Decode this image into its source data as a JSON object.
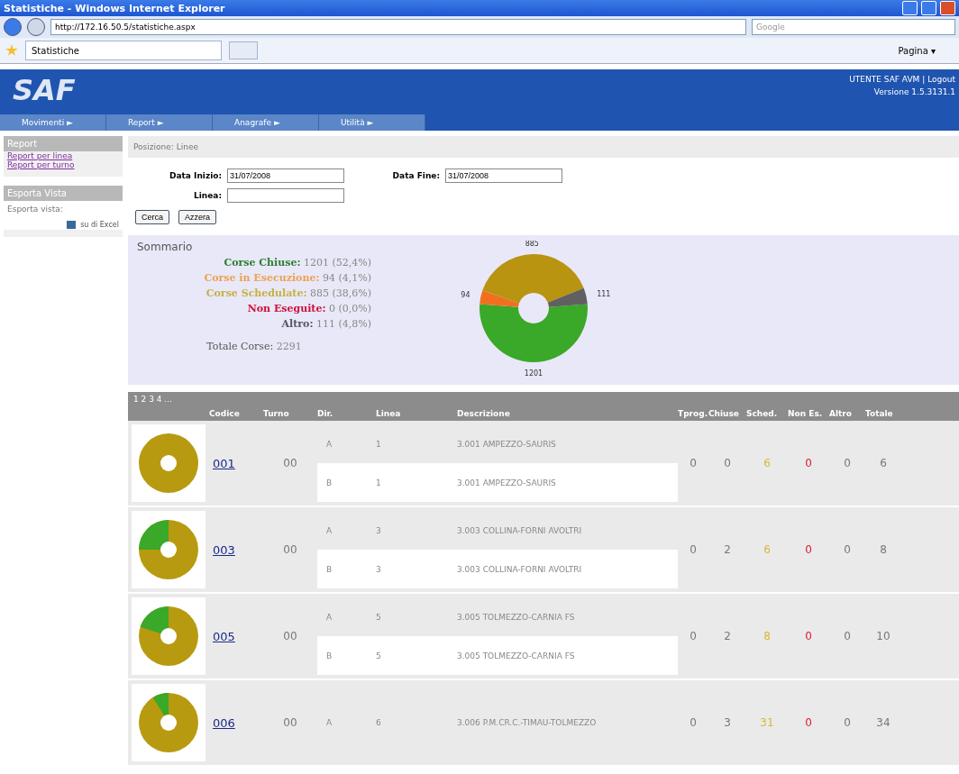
{
  "window": {
    "title": "Statistiche - Windows Internet Explorer"
  },
  "browser": {
    "address": "http://172.16.50.5/statistiche.aspx",
    "search_placeholder": "Google",
    "tab": "Statistiche",
    "tools": [
      "Pagina ▾"
    ]
  },
  "header": {
    "logo": "SAF",
    "user": "UTENTE SAF AVM",
    "separator": "|",
    "logout": "Logout",
    "version": "Versione 1.5.3131.1"
  },
  "menu": [
    {
      "label": "Movimenti",
      "arrow": "►"
    },
    {
      "label": "Report",
      "arrow": "►"
    },
    {
      "label": "Anagrafe",
      "arrow": "►"
    },
    {
      "label": "Utilità",
      "arrow": "►"
    }
  ],
  "sidebar": {
    "sections": [
      {
        "title": "Report",
        "items": [
          {
            "kind": "link",
            "text": "Report per linea"
          },
          {
            "kind": "link",
            "text": "Report per turno"
          }
        ]
      },
      {
        "title": "Esporta Vista",
        "items": [
          {
            "kind": "text",
            "text": "Esporta vista:"
          },
          {
            "kind": "export",
            "text": "su di Excel"
          }
        ]
      }
    ]
  },
  "breadcrumb": "Posizione: Linee",
  "form": {
    "fields": [
      {
        "label": "Data Inizio:",
        "value": "31/07/2008"
      },
      {
        "label": "Data Fine:",
        "value": "31/07/2008"
      },
      {
        "label": "Linea:"
      }
    ],
    "buttons": [
      "Cerca",
      "Azzera"
    ]
  },
  "summary": {
    "title": "Sommario",
    "lines": [
      {
        "label": "Corse Chiuse:",
        "value": "1201 (52,4%)",
        "color": "#2e7d32"
      },
      {
        "label": "Corse in Esecuzione:",
        "value": "94 (4,1%)",
        "color": "#f0a050"
      },
      {
        "label": "Corse Schedulate:",
        "value": "885 (38,6%)",
        "color": "#c8b040"
      },
      {
        "label": "Non Eseguite:",
        "value": "0 (0,0%)",
        "color": "#d0103a"
      },
      {
        "label": "Altro:",
        "value": "111 (4,8%)",
        "color": "#555566"
      }
    ],
    "total_label": "Totale Corse:",
    "total": "2291",
    "chart_data": {
      "type": "donut",
      "values": [
        1201,
        94,
        885,
        111
      ],
      "colors": [
        "#3aa828",
        "#f07020",
        "#b89410",
        "#606060"
      ],
      "data_labels": true,
      "value_labels": [
        "1201",
        "94",
        "885",
        "111"
      ]
    }
  },
  "grid": {
    "pager": "1 2 3 4 ...",
    "columns": [
      "Codice",
      "Turno",
      "Dir.",
      "Linea",
      "Descrizione",
      "Tprog.",
      "Chiuse",
      "Sched.",
      "Non Es.",
      "Altro",
      "Totale"
    ],
    "rows": [
      {
        "code": "001",
        "turno": "00",
        "subs": [
          {
            "dir": "A",
            "linea": "1",
            "desc": "3.001 AMPEZZO-SAURIS"
          },
          {
            "dir": "B",
            "linea": "1",
            "desc": "3.001 AMPEZZO-SAURIS"
          }
        ],
        "tprog": "0",
        "chiuse": "0",
        "sched": "6",
        "non_es": "0",
        "altro": "0",
        "totale": "6"
      },
      {
        "code": "003",
        "turno": "00",
        "subs": [
          {
            "dir": "A",
            "linea": "3",
            "desc": "3.003 COLLINA-FORNI AVOLTRI"
          },
          {
            "dir": "B",
            "linea": "3",
            "desc": "3.003 COLLINA-FORNI AVOLTRI"
          }
        ],
        "tprog": "0",
        "chiuse": "2",
        "sched": "6",
        "non_es": "0",
        "altro": "0",
        "totale": "8"
      },
      {
        "code": "005",
        "turno": "00",
        "subs": [
          {
            "dir": "A",
            "linea": "5",
            "desc": "3.005 TOLMEZZO-CARNIA FS"
          },
          {
            "dir": "B",
            "linea": "5",
            "desc": "3.005 TOLMEZZO-CARNIA FS"
          }
        ],
        "tprog": "0",
        "chiuse": "2",
        "sched": "8",
        "non_es": "0",
        "altro": "0",
        "totale": "10"
      },
      {
        "code": "006",
        "turno": "00",
        "subs": [
          {
            "dir": "A",
            "linea": "6",
            "desc": "3.006 P.M.CR.C.-TIMAU-TOLMEZZO"
          }
        ],
        "tprog": "0",
        "chiuse": "3",
        "sched": "31",
        "non_es": "0",
        "altro": "0",
        "totale": "34"
      }
    ]
  }
}
